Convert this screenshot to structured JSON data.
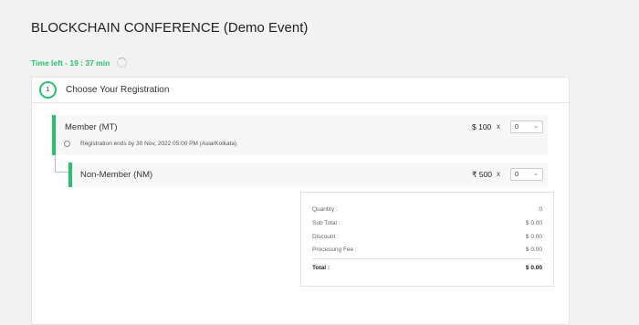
{
  "event": {
    "title": "BLOCKCHAIN CONFERENCE (Demo Event)"
  },
  "timer": {
    "label": "Time left - 19 : 37 min"
  },
  "step": {
    "number": "1",
    "title": "Choose Your Registration"
  },
  "registrations": [
    {
      "name": "Member (MT)",
      "price": "$ 100",
      "times": "x",
      "qty": "0",
      "note": "Registration ends by 30 Nov, 2022 05:00 PM (Asia/Kolkata)"
    },
    {
      "name": "Non-Member (NM)",
      "price": "₹ 500",
      "times": "x",
      "qty": "0"
    }
  ],
  "summary": {
    "quantity_label": "Quantity :",
    "quantity_value": "0",
    "subtotal_label": "Sub Total :",
    "subtotal_value": "$ 0.00",
    "discount_label": "Discount :",
    "discount_value": "$ 0.00",
    "fee_label": "Processing Fee :",
    "fee_value": "$ 0.00",
    "total_label": "Total :",
    "total_value": "$ 0.00"
  },
  "colors": {
    "accent": "#27c26c"
  },
  "icons": {
    "timer": "loading-spinner-icon",
    "note": "clock-icon",
    "select": "chevron-down-icon"
  }
}
